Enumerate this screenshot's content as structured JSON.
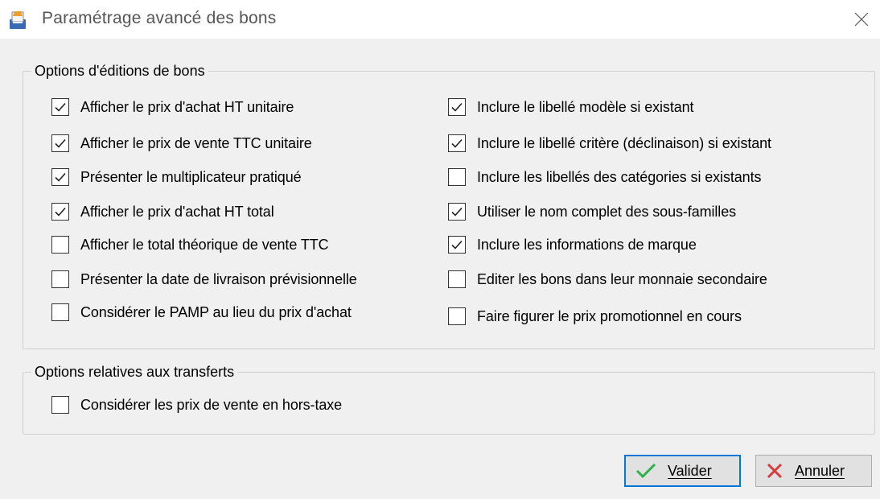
{
  "window": {
    "title": "Paramétrage avancé des bons",
    "close_glyph": "✕"
  },
  "groups": {
    "editions": {
      "title": "Options d'éditions de bons",
      "left": [
        {
          "label": "Afficher le prix d'achat HT unitaire",
          "checked": true
        },
        {
          "label": "Afficher le prix de vente TTC unitaire",
          "checked": true
        },
        {
          "label": "Présenter le multiplicateur pratiqué",
          "checked": true
        },
        {
          "label": "Afficher le prix d'achat HT total",
          "checked": true
        },
        {
          "label": "Afficher le total théorique de vente TTC",
          "checked": false
        },
        {
          "label": "Présenter la date de livraison prévisionnelle",
          "checked": false
        },
        {
          "label": "Considérer le PAMP au lieu du prix d'achat",
          "checked": false
        }
      ],
      "right": [
        {
          "label": "Inclure le libellé modèle si existant",
          "checked": true
        },
        {
          "label": "Inclure le libellé critère (déclinaison) si existant",
          "checked": true
        },
        {
          "label": "Inclure les libellés des catégories si existants",
          "checked": false
        },
        {
          "label": "Utiliser le nom complet des sous-familles",
          "checked": true
        },
        {
          "label": "Inclure les informations de marque",
          "checked": true
        },
        {
          "label": "Editer les bons dans leur monnaie secondaire",
          "checked": false
        },
        {
          "label": "Faire figurer le prix promotionnel en cours",
          "checked": false
        }
      ]
    },
    "transferts": {
      "title": "Options relatives aux transferts",
      "items": [
        {
          "label": "Considérer les prix de vente en hors-taxe",
          "checked": false
        }
      ]
    }
  },
  "buttons": {
    "validate": {
      "label": "Valider",
      "icon": "checkmark-icon",
      "color": "#2bb34a"
    },
    "cancel": {
      "label": "Annuler",
      "icon": "x-icon",
      "color": "#d83b3b"
    }
  },
  "colors": {
    "accent": "#0078d7",
    "background": "#f0f0f0"
  }
}
